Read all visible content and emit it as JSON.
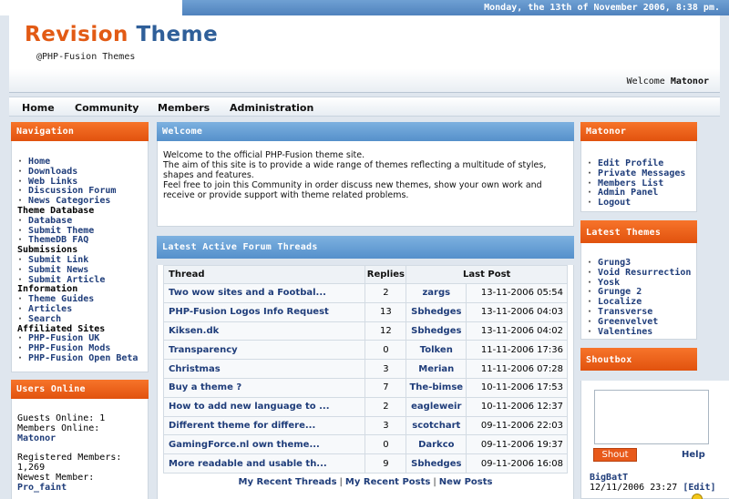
{
  "header": {
    "date": "Monday, the 13th of November 2006, 8:38 pm.",
    "logo_word1": "Revision",
    "logo_word2": "Theme",
    "logo_sub": "@PHP-Fusion Themes",
    "welcome_text": "Welcome",
    "welcome_user": "Matonor"
  },
  "menu": [
    "Home",
    "Community",
    "Members",
    "Administration"
  ],
  "navigation": {
    "title": "Navigation",
    "items": [
      {
        "type": "link",
        "label": "Home"
      },
      {
        "type": "link",
        "label": "Downloads"
      },
      {
        "type": "link",
        "label": "Web Links"
      },
      {
        "type": "link",
        "label": "Discussion Forum"
      },
      {
        "type": "link",
        "label": "News Categories"
      },
      {
        "type": "header",
        "label": "Theme Database"
      },
      {
        "type": "link",
        "label": "Database"
      },
      {
        "type": "link",
        "label": "Submit Theme"
      },
      {
        "type": "link",
        "label": "ThemeDB FAQ"
      },
      {
        "type": "header",
        "label": "Submissions"
      },
      {
        "type": "link",
        "label": "Submit Link"
      },
      {
        "type": "link",
        "label": "Submit News"
      },
      {
        "type": "link",
        "label": "Submit Article"
      },
      {
        "type": "header",
        "label": "Information"
      },
      {
        "type": "link",
        "label": "Theme Guides"
      },
      {
        "type": "link",
        "label": "Articles"
      },
      {
        "type": "link",
        "label": "Search"
      },
      {
        "type": "header",
        "label": "Affiliated Sites"
      },
      {
        "type": "link",
        "label": "PHP-Fusion UK"
      },
      {
        "type": "link",
        "label": "PHP-Fusion Mods"
      },
      {
        "type": "link",
        "label": "PHP-Fusion Open Beta"
      }
    ]
  },
  "users_online": {
    "title": "Users Online",
    "guests": "Guests Online: 1",
    "members": "Members Online:",
    "member_name": "Matonor",
    "registered_label": "Registered Members:",
    "registered_count": "1,269",
    "newest_label": "Newest Member:",
    "newest_name": "Pro_faint"
  },
  "welcome_panel": {
    "title": "Welcome",
    "lines": [
      "Welcome to the official PHP-Fusion theme site.",
      "The aim of this site is to provide a wide range of themes reflecting a multitude of styles, shapes and features.",
      "Feel free to join this Community in order discuss new themes, show your own work and receive or provide support with theme related problems."
    ]
  },
  "forum_panel": {
    "title": "Latest Active Forum Threads",
    "columns": [
      "Thread",
      "Replies",
      "",
      "Last Post"
    ],
    "rows": [
      {
        "thread": "Two wow sites and a Footbal...",
        "replies": "2",
        "author": "zargs",
        "date": "13-11-2006 05:54"
      },
      {
        "thread": "PHP-Fusion Logos Info Request",
        "replies": "13",
        "author": "Sbhedges",
        "date": "13-11-2006 04:03"
      },
      {
        "thread": "Kiksen.dk",
        "replies": "12",
        "author": "Sbhedges",
        "date": "13-11-2006 04:02"
      },
      {
        "thread": "Transparency",
        "replies": "0",
        "author": "Tolken",
        "date": "11-11-2006 17:36"
      },
      {
        "thread": "Christmas",
        "replies": "3",
        "author": "Merian",
        "date": "11-11-2006 07:28"
      },
      {
        "thread": "Buy a theme ?",
        "replies": "7",
        "author": "The-bimse",
        "date": "10-11-2006 17:53"
      },
      {
        "thread": "How to add new language to ...",
        "replies": "2",
        "author": "eagleweir",
        "date": "10-11-2006 12:37"
      },
      {
        "thread": "Different theme for differe...",
        "replies": "3",
        "author": "scotchart",
        "date": "09-11-2006 22:03"
      },
      {
        "thread": "GamingForce.nl own theme...",
        "replies": "0",
        "author": "Darkco",
        "date": "09-11-2006 19:37"
      },
      {
        "thread": "More readable and usable th...",
        "replies": "9",
        "author": "Sbhedges",
        "date": "09-11-2006 16:08"
      }
    ],
    "links": [
      "My Recent Threads",
      "My Recent Posts",
      "New Posts"
    ]
  },
  "user_panel": {
    "title": "Matonor",
    "items": [
      "Edit Profile",
      "Private Messages",
      "Members List",
      "Admin Panel",
      "Logout"
    ]
  },
  "themes_panel": {
    "title": "Latest Themes",
    "items": [
      "Grung3",
      "Void Resurrection",
      "Yosk",
      "Grunge 2",
      "Localize",
      "Transverse",
      "Greenvelvet",
      "Valentines"
    ]
  },
  "shoutbox": {
    "title": "Shoutbox",
    "button": "Shout",
    "help": "Help",
    "last_author": "BigBatT",
    "last_date": "12/11/2006 23:27",
    "edit_label": "[Edit]"
  }
}
